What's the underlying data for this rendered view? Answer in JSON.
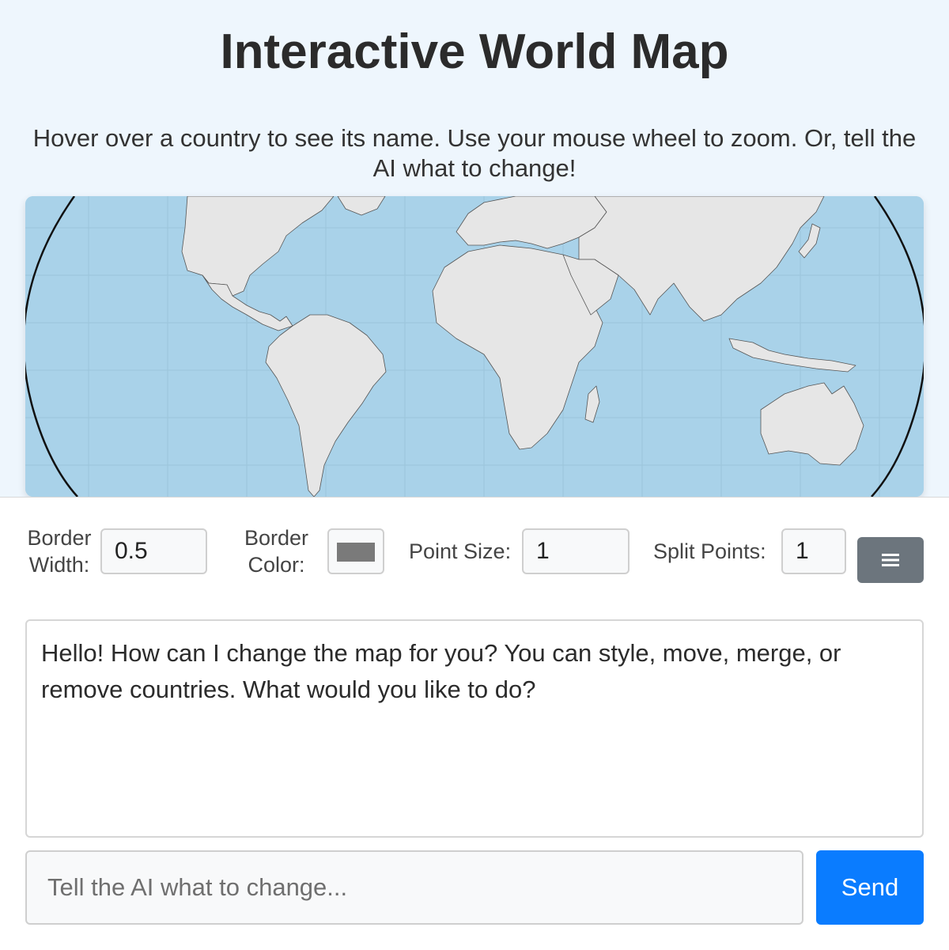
{
  "header": {
    "title": "Interactive World Map",
    "subtitle": "Hover over a country to see its name. Use your mouse wheel to zoom. Or, tell the AI what to change!"
  },
  "map": {
    "ocean_color": "#a9d2e9",
    "land_color": "#e6e6e6",
    "border_color": "#555555"
  },
  "controls": {
    "border_width": {
      "label_line1": "Border",
      "label_line2": "Width:",
      "value": "0.5"
    },
    "border_color": {
      "label_line1": "Border",
      "label_line2": "Color:",
      "value": "#7a7a7a"
    },
    "point_size": {
      "label": "Point Size:",
      "value": "1"
    },
    "split_points": {
      "label": "Split Points:",
      "value": "1"
    },
    "menu_icon": "menu-icon"
  },
  "chat": {
    "messages": [
      {
        "role": "ai",
        "text": "Hello! How can I change the map for you? You can style, move, merge, or remove countries. What would you like to do?"
      }
    ],
    "input_placeholder": "Tell the AI what to change...",
    "send_label": "Send"
  }
}
